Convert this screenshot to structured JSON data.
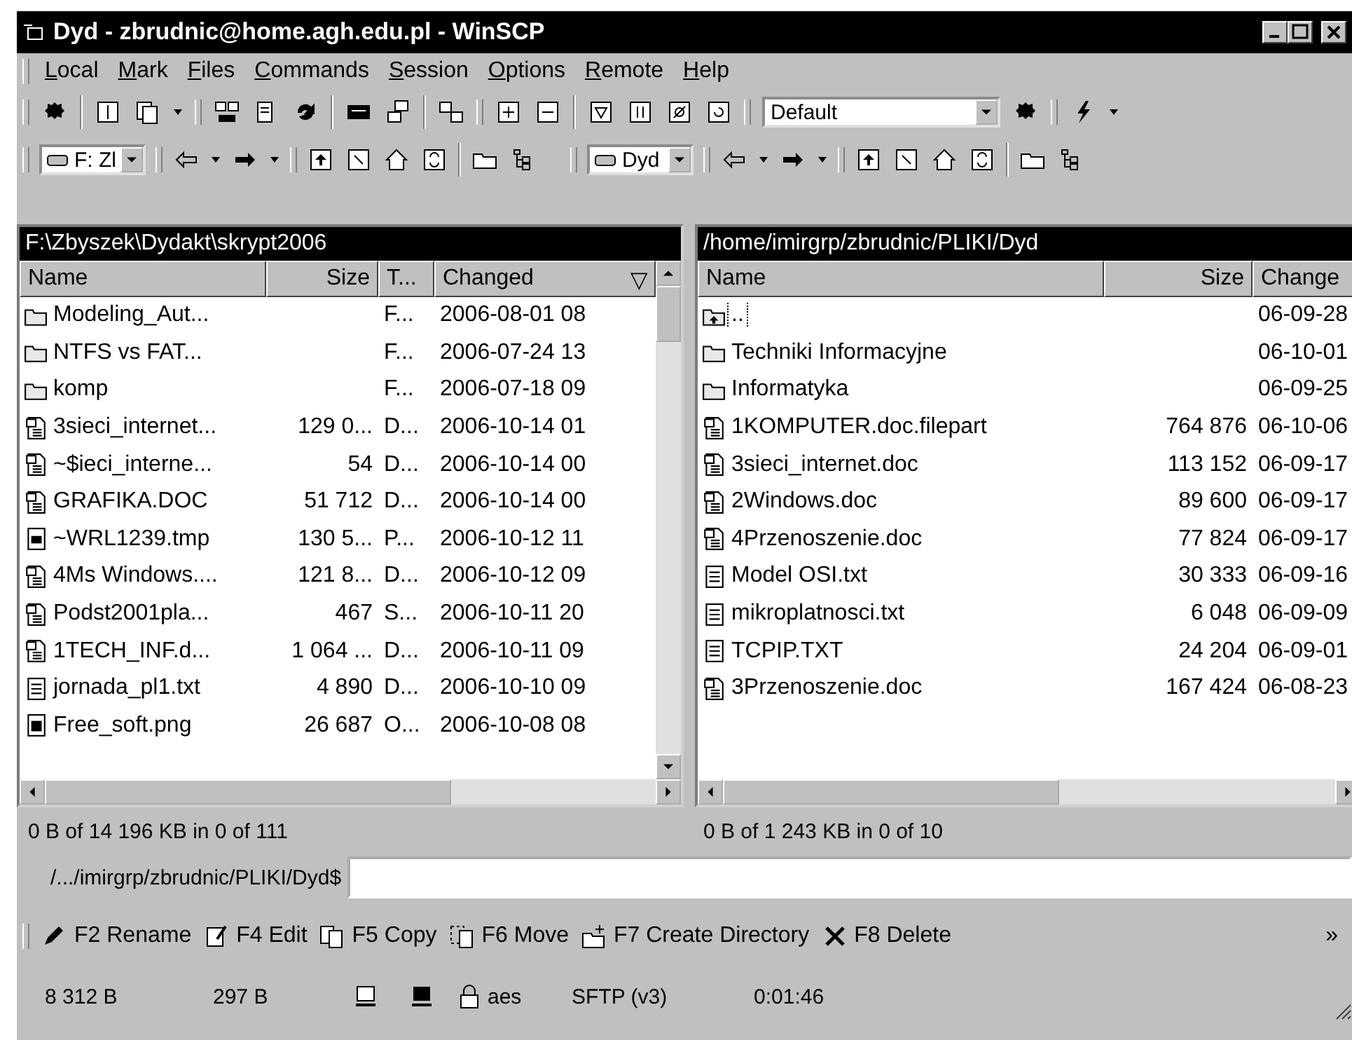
{
  "window": {
    "title": "Dyd - zbrudnic@home.agh.edu.pl - WinSCP"
  },
  "menu": [
    "Local",
    "Mark",
    "Files",
    "Commands",
    "Session",
    "Options",
    "Remote",
    "Help"
  ],
  "toolbar": {
    "preset": "Default"
  },
  "left": {
    "drive": "F: Zl",
    "path": "F:\\Zbyszek\\Dydakt\\skrypt2006",
    "columns": [
      "Name",
      "Size",
      "T...",
      "Changed"
    ],
    "sort_mark": "▽",
    "rows": [
      {
        "kind": "folder",
        "focused": false,
        "cells": [
          "Modeling_Aut...",
          "",
          "F...",
          "2006-08-01  08"
        ]
      },
      {
        "kind": "folder",
        "focused": false,
        "cells": [
          "NTFS vs FAT...",
          "",
          "F...",
          "2006-07-24  13"
        ]
      },
      {
        "kind": "folder",
        "focused": false,
        "cells": [
          "komp",
          "",
          "F...",
          "2006-07-18  09"
        ]
      },
      {
        "kind": "doc",
        "focused": false,
        "cells": [
          "3sieci_internet...",
          "129 0...",
          "D...",
          "2006-10-14  01"
        ]
      },
      {
        "kind": "doc",
        "focused": false,
        "cells": [
          "~$ieci_interne...",
          "54",
          "D...",
          "2006-10-14  00"
        ]
      },
      {
        "kind": "doc",
        "focused": false,
        "cells": [
          "GRAFIKA.DOC",
          "51 712",
          "D...",
          "2006-10-14  00"
        ]
      },
      {
        "kind": "tmp",
        "focused": false,
        "cells": [
          "~WRL1239.tmp",
          "130 5...",
          "P...",
          "2006-10-12  11"
        ]
      },
      {
        "kind": "doc",
        "focused": false,
        "cells": [
          "4Ms Windows....",
          "121 8...",
          "D...",
          "2006-10-12  09"
        ]
      },
      {
        "kind": "doc",
        "focused": false,
        "cells": [
          "Podst2001pla...",
          "467",
          "S...",
          "2006-10-11  20"
        ]
      },
      {
        "kind": "doc",
        "focused": false,
        "cells": [
          "1TECH_INF.d...",
          "1 064 ...",
          "D...",
          "2006-10-11  09"
        ]
      },
      {
        "kind": "txt",
        "focused": false,
        "cells": [
          "jornada_pl1.txt",
          "4 890",
          "D...",
          "2006-10-10  09"
        ]
      },
      {
        "kind": "image",
        "focused": false,
        "cells": [
          "Free_soft.png",
          "26 687",
          "O...",
          "2006-10-08  08"
        ]
      }
    ],
    "summary": "0 B of 14 196 KB in 0 of 111"
  },
  "right": {
    "drive": "Dyd",
    "path": "/home/imirgrp/zbrudnic/PLIKI/Dyd",
    "columns": [
      "Name",
      "Size",
      "Change"
    ],
    "rows": [
      {
        "kind": "up",
        "focused": true,
        "cells": [
          "..",
          "",
          "06-09-28"
        ]
      },
      {
        "kind": "folder",
        "focused": false,
        "cells": [
          "Techniki Informacyjne",
          "",
          "06-10-01"
        ]
      },
      {
        "kind": "folder",
        "focused": false,
        "cells": [
          "Informatyka",
          "",
          "06-09-25"
        ]
      },
      {
        "kind": "doc",
        "focused": false,
        "cells": [
          "1KOMPUTER.doc.filepart",
          "764 876",
          "06-10-06"
        ]
      },
      {
        "kind": "doc",
        "focused": false,
        "cells": [
          "3sieci_internet.doc",
          "113 152",
          "06-09-17"
        ]
      },
      {
        "kind": "doc",
        "focused": false,
        "cells": [
          "2Windows.doc",
          "89 600",
          "06-09-17"
        ]
      },
      {
        "kind": "doc",
        "focused": false,
        "cells": [
          "4Przenoszenie.doc",
          "77 824",
          "06-09-17"
        ]
      },
      {
        "kind": "txt",
        "focused": false,
        "cells": [
          "Model OSI.txt",
          "30 333",
          "06-09-16"
        ]
      },
      {
        "kind": "txt",
        "focused": false,
        "cells": [
          "mikroplatnosci.txt",
          "6 048",
          "06-09-09"
        ]
      },
      {
        "kind": "txt",
        "focused": false,
        "cells": [
          "TCPIP.TXT",
          "24 204",
          "06-09-01"
        ]
      },
      {
        "kind": "doc",
        "focused": false,
        "cells": [
          "3Przenoszenie.doc",
          "167 424",
          "06-08-23"
        ]
      }
    ],
    "summary": "0 B of 1 243 KB in 0 of 10"
  },
  "command_line": {
    "prompt": "/.../imirgrp/zbrudnic/PLIKI/Dyd$"
  },
  "function_keys": [
    {
      "kind": "rename",
      "label": "F2 Rename"
    },
    {
      "kind": "edit",
      "label": "F4 Edit"
    },
    {
      "kind": "copy",
      "label": "F5 Copy"
    },
    {
      "kind": "move",
      "label": "F6 Move"
    },
    {
      "kind": "mkdir",
      "label": "F7 Create Directory"
    },
    {
      "kind": "delete",
      "label": "F8 Delete"
    }
  ],
  "more": "»",
  "status_bar": {
    "sent": "8 312 B",
    "received": "297 B",
    "cipher": "aes",
    "protocol": "SFTP (v3)",
    "duration": "0:01:46"
  }
}
